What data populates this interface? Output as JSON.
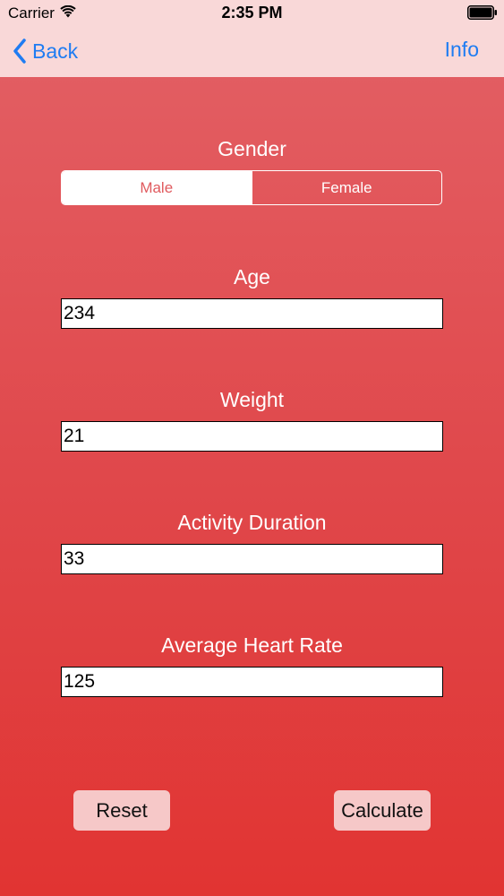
{
  "status_bar": {
    "carrier": "Carrier",
    "time": "2:35 PM",
    "icons": [
      "wifi-icon",
      "battery-icon"
    ]
  },
  "nav": {
    "back_label": "Back",
    "back_icon": "chevron-left-icon",
    "info_label": "Info",
    "tint_color": "#1f7cf2",
    "background": "#f9d8d8"
  },
  "form": {
    "gender": {
      "label": "Gender",
      "options": [
        "Male",
        "Female"
      ],
      "selected": "Male"
    },
    "age": {
      "label": "Age",
      "value": "234"
    },
    "weight": {
      "label": "Weight",
      "value": "21"
    },
    "activity_duration": {
      "label": "Activity Duration",
      "value": "33"
    },
    "average_heart_rate": {
      "label": "Average Heart Rate",
      "value": "125"
    }
  },
  "actions": {
    "reset_label": "Reset",
    "calculate_label": "Calculate"
  },
  "colors": {
    "background_top": "#e36166",
    "background_bottom": "#e13432",
    "button_background": "#f6c8c8",
    "selected_segment_text": "#e05a5e"
  }
}
